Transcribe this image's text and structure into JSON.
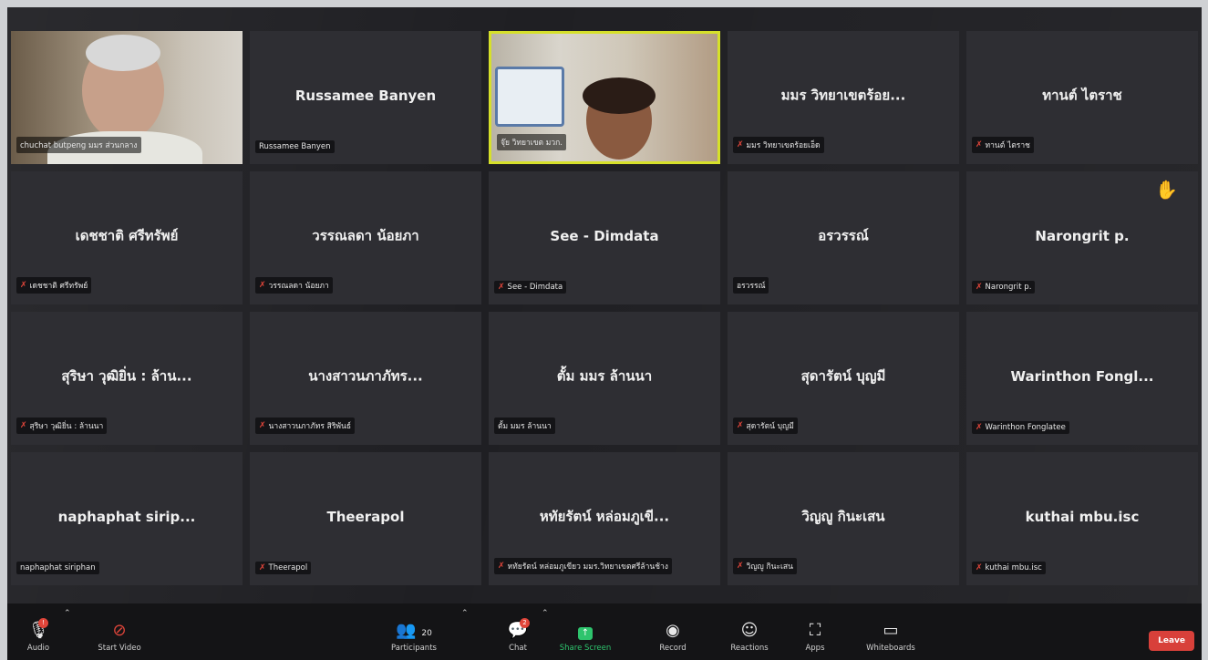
{
  "participants": [
    {
      "display": "",
      "label": "chuchat butpeng มมร ส่วนกลาง",
      "muted": false
    },
    {
      "display": "Russamee Banyen",
      "label": "Russamee Banyen",
      "muted": false
    },
    {
      "display": "",
      "label": "จุ๊ย วิทยาเขต มวก.",
      "muted": false
    },
    {
      "display": "มมร วิทยาเขตร้อย...",
      "label": "มมร วิทยาเขตร้อยเอ็ด",
      "muted": true
    },
    {
      "display": "ทานต์ ไตราช",
      "label": "ทานต์ ไตราช",
      "muted": true
    },
    {
      "display": "เดชชาติ ศรีทรัพย์",
      "label": "เดชชาติ ศรีทรัพย์",
      "muted": true
    },
    {
      "display": "วรรณลดา น้อยภา",
      "label": "วรรณลดา น้อยภา",
      "muted": true
    },
    {
      "display": "See - Dimdata",
      "label": "See - Dimdata",
      "muted": true
    },
    {
      "display": "อรวรรณ์",
      "label": "อรวรรณ์",
      "muted": false
    },
    {
      "display": "Narongrit p.",
      "label": "Narongrit p.",
      "muted": true
    },
    {
      "display": "สุริษา วุฒิยิ่น : ล้าน...",
      "label": "สุริษา วุฒิยิ่น : ล้านนา",
      "muted": true
    },
    {
      "display": "นางสาวนภาภัทร...",
      "label": "นางสาวนภาภัทร สิริพันธ์",
      "muted": true
    },
    {
      "display": "ตั้ม มมร ล้านนา",
      "label": "ตั้ม มมร ล้านนา",
      "muted": false
    },
    {
      "display": "สุดารัตน์ บุญมี",
      "label": "สุดารัตน์ บุญมี",
      "muted": true
    },
    {
      "display": "Warinthon Fongl...",
      "label": "Warinthon Fonglatee",
      "muted": true
    },
    {
      "display": "naphaphat sirip...",
      "label": "naphaphat siriphan",
      "muted": false
    },
    {
      "display": "Theerapol",
      "label": "Theerapol",
      "muted": true
    },
    {
      "display": "หทัยรัตน์ หล่อมภูเขี...",
      "label": "หทัยรัตน์ หล่อมภูเขียว มมร.วิทยาเขตศรีล้านช้าง",
      "muted": true
    },
    {
      "display": "วิญญู กินะเสน",
      "label": "วิญญู กินะเสน",
      "muted": true
    },
    {
      "display": "kuthai mbu.isc",
      "label": "kuthai mbu.isc",
      "muted": true
    }
  ],
  "toolbar": {
    "audio": "Audio",
    "start_video": "Start Video",
    "participants": "Participants",
    "participants_count": "20",
    "chat": "Chat",
    "share_screen": "Share Screen",
    "record": "Record",
    "reactions": "Reactions",
    "apps": "Apps",
    "whiteboards": "Whiteboards",
    "leave": "Leave"
  },
  "colors": {
    "active_speaker": "#d6e02a",
    "leave": "#d8403a",
    "share": "#2ec46d",
    "muted": "#e0453a"
  },
  "icons": {
    "hand": "raised-hand-icon"
  }
}
